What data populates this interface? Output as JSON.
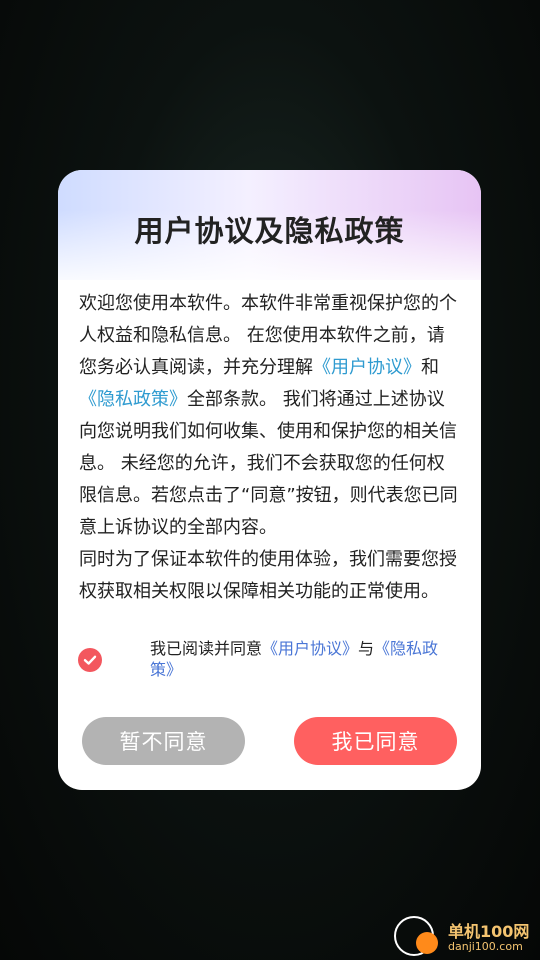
{
  "dialog": {
    "title": "用户协议及隐私政策",
    "content": {
      "p1_a": "欢迎您使用本软件。本软件非常重视保护您的个人权益和隐私信息。 在您使用本软件之前，请您务必认真阅读，并充分理解",
      "p1_link1": "《用户协议》",
      "p1_mid": "和",
      "p1_link2": "《隐私政策》",
      "p1_b": "全部条款。 我们将通过上述协议向您说明我们如何收集、使用和保护您的相关信息。 未经您的允许，我们不会获取您的任何权限信息。若您点击了“同意”按钮，则代表您已同意上诉协议的全部内容。",
      "p2": " 同时为了保证本软件的使用体验，我们需要您授权获取相关权限以保障相关功能的正常使用。"
    },
    "agreement": {
      "prefix": "我已阅读并同意",
      "link1": "《用户协议》",
      "mid": "与",
      "link2": "《隐私政策》"
    },
    "buttons": {
      "disagree": "暂不同意",
      "agree": "我已同意"
    }
  },
  "watermark": {
    "name": "单机100网",
    "domain": "danji100.com"
  },
  "colors": {
    "agree_button": "#ff6060",
    "disagree_button": "#b3b3b3",
    "link": "#2f9bd0",
    "check": "#f3575e"
  }
}
